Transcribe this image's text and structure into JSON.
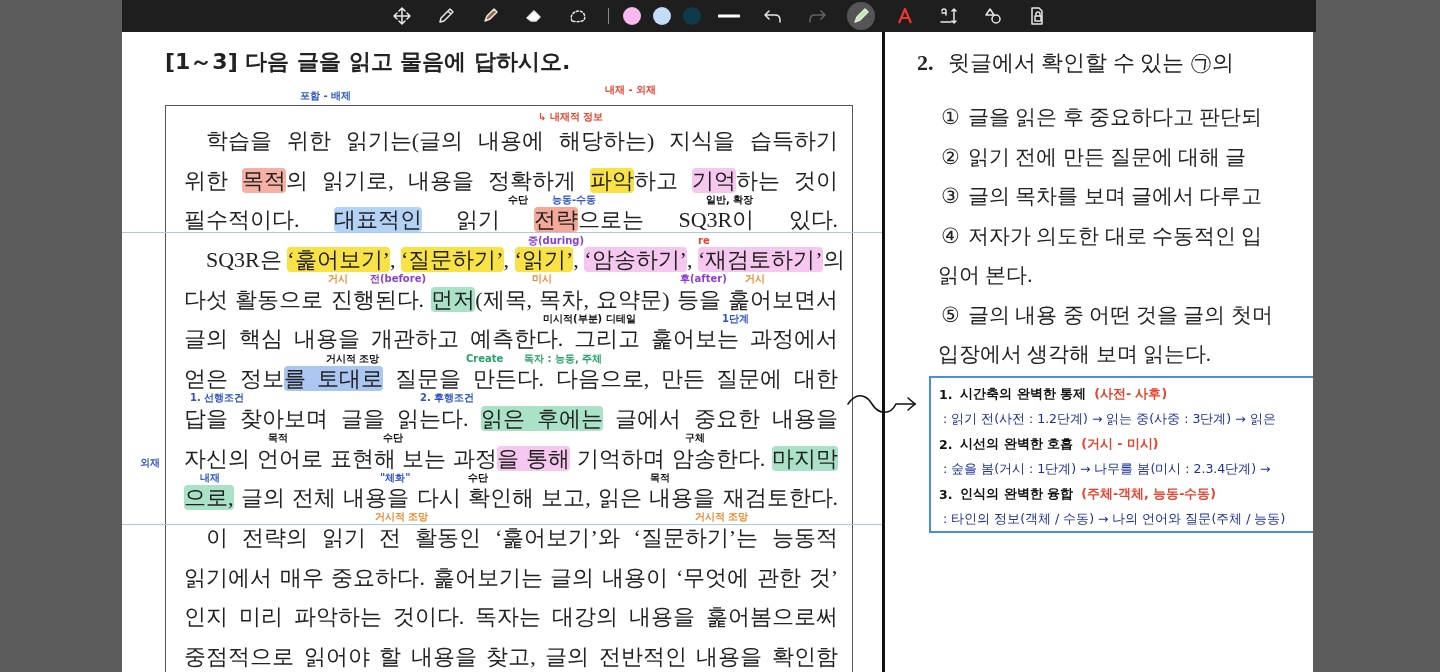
{
  "toolbar": {
    "tools": [
      {
        "kind": "move",
        "selected": false,
        "disabled": false
      },
      {
        "kind": "pen",
        "selected": false,
        "disabled": false
      },
      {
        "kind": "highlighter",
        "selected": false,
        "disabled": false
      },
      {
        "kind": "eraser",
        "selected": false,
        "disabled": false
      },
      {
        "kind": "lasso",
        "selected": false,
        "disabled": false
      }
    ],
    "colors": [
      {
        "color": "#f9b8f0",
        "selected": false
      },
      {
        "color": "#c3dcf8",
        "selected": false
      },
      {
        "color": "#0e3b4a",
        "selected": false
      }
    ],
    "actions": [
      {
        "kind": "stroke",
        "selected": false,
        "disabled": false
      },
      {
        "kind": "undo",
        "selected": false,
        "disabled": false
      },
      {
        "kind": "redo",
        "selected": false,
        "disabled": true
      },
      {
        "kind": "highlighter-pen",
        "selected": true,
        "disabled": false
      },
      {
        "kind": "text-color",
        "selected": false,
        "disabled": false
      },
      {
        "kind": "text-box",
        "selected": false,
        "disabled": false
      },
      {
        "kind": "shapes",
        "selected": false,
        "disabled": false
      },
      {
        "kind": "page-lock",
        "selected": false,
        "disabled": false
      }
    ]
  },
  "left_page": {
    "heading": "[1～3] 다음 글을 읽고 물음에 답하시오.",
    "paragraphs": [
      {
        "lines": [
          {
            "segments": [
              {
                "text": "학습을 위한 읽기는(글의 내용에 해당하는) 지식을 습득하기"
              }
            ]
          },
          {
            "segments": [
              {
                "text": "위한 "
              },
              {
                "text": "목적",
                "color": "#f7b1a4"
              },
              {
                "text": "의 읽기로, 내용을 정확하게 "
              },
              {
                "text": "파악",
                "color": "#f8e246"
              },
              {
                "text": "하고 "
              },
              {
                "text": "기억",
                "color": "#f6c8f0"
              },
              {
                "text": "하는 것이"
              }
            ]
          },
          {
            "segments": [
              {
                "text": "필수적이다. "
              },
              {
                "text": "대표적인",
                "color": "#b3d3f6"
              },
              {
                "text": " 읽기 "
              },
              {
                "text": "전략",
                "color": "#f4a89a"
              },
              {
                "text": "으로는 SQ3R이 있다."
              }
            ]
          }
        ]
      },
      {
        "lines": [
          {
            "segments": [
              {
                "text": "SQ3R은 "
              },
              {
                "text": "‘훑어보기’",
                "color": "#f8e246"
              },
              {
                "text": ", "
              },
              {
                "text": "‘질문하기’",
                "color": "#f8e246"
              },
              {
                "text": ", "
              },
              {
                "text": "‘읽기’",
                "color": "#f8e246"
              },
              {
                "text": ", "
              },
              {
                "text": "‘암송하기’",
                "color": "#f6c8f0"
              },
              {
                "text": ", "
              },
              {
                "text": "‘재검토하기’",
                "color": "#f6c8f0"
              },
              {
                "text": "의"
              }
            ]
          },
          {
            "segments": [
              {
                "text": "다섯 활동으로 진행된다. "
              },
              {
                "text": "먼저",
                "color": "#a9e2c6"
              },
              {
                "text": "(제목, 목차, 요약문) 등을 훑어보면서"
              }
            ]
          },
          {
            "segments": [
              {
                "text": "글의 핵심 내용을 개관하고 예측한다. 그리고 훑어보는 과정에서"
              }
            ]
          },
          {
            "segments": [
              {
                "text": "얻은 정보"
              },
              {
                "text": "를 토대로",
                "color": "#aac6f1"
              },
              {
                "text": " 질문을 만든다. 다음으로, 만든 질문에 대한"
              }
            ]
          },
          {
            "segments": [
              {
                "text": "답을 찾아보며 글을 읽는다. "
              },
              {
                "text": "읽은 후에는",
                "color": "#a9e2c6"
              },
              {
                "text": " 글에서 중요한 내용을"
              }
            ]
          },
          {
            "segments": [
              {
                "text": "자신의 언어로 표현해 보는 과정"
              },
              {
                "text": "을 통해",
                "color": "#f6c8f0"
              },
              {
                "text": " 기억하며 암송한다. "
              },
              {
                "text": "마지막",
                "color": "#a9e2c6"
              }
            ]
          },
          {
            "segments": [
              {
                "text": "으로,",
                "color": "#a9e2c6"
              },
              {
                "text": " 글의 전체 내용을 다시 확인해 보고, 읽은 내용을 재검토한다."
              }
            ]
          }
        ]
      },
      {
        "lines": [
          {
            "segments": [
              {
                "text": "이 전략의 읽기 전 활동인 ‘훑어보기’와 ‘질문하기’는 능동적"
              }
            ]
          },
          {
            "segments": [
              {
                "text": "읽기에서 매우 중요하다. 훑어보기는 글의 내용이 ‘무엇에 관한 것’"
              }
            ]
          },
          {
            "segments": [
              {
                "text": "인지 미리 파악하는 것이다. 독자는 대강의 내용을 훑어봄으로써"
              }
            ]
          },
          {
            "segments": [
              {
                "text": "중점적으로 읽어야 할 내용을 찾고, 글의 전반적인 내용을 확인함"
              }
            ]
          }
        ]
      }
    ],
    "annotations": [
      {
        "text": "포함 - 배제",
        "color": "#2d55c8"
      },
      {
        "text": "내재 - 외재",
        "color": "#e8412c"
      },
      {
        "text": "↳ 내재적 정보",
        "color": "#e8412c"
      },
      {
        "text": "수단",
        "color": "#111111"
      },
      {
        "text": "능동-수동",
        "color": "#2d55c8"
      },
      {
        "text": "일반, 확장",
        "color": "#111111"
      },
      {
        "text": "중(during)",
        "color": "#8a3fd1"
      },
      {
        "text": "re",
        "color": "#e8412c"
      },
      {
        "text": "거시",
        "color": "#f08a2c"
      },
      {
        "text": "전(before)",
        "color": "#8a3fd1"
      },
      {
        "text": "미시",
        "color": "#f08a2c"
      },
      {
        "text": "후(after)",
        "color": "#8a3fd1"
      },
      {
        "text": "거시",
        "color": "#f08a2c"
      },
      {
        "text": "미시적(부분) 디테일",
        "color": "#111111"
      },
      {
        "text": "1단계",
        "color": "#2d55c8"
      },
      {
        "text": "거시적 조망",
        "color": "#111111"
      },
      {
        "text": "Create",
        "color": "#2aa06a"
      },
      {
        "text": "독자 : 능동, 주체",
        "color": "#2aa06a"
      },
      {
        "text": "1. 선행조건",
        "color": "#2d55c8"
      },
      {
        "text": "2. 후행조건",
        "color": "#2d55c8"
      },
      {
        "text": "목적",
        "color": "#111111"
      },
      {
        "text": "수단",
        "color": "#111111"
      },
      {
        "text": "구체",
        "color": "#111111"
      },
      {
        "text": "외재",
        "color": "#2d55c8"
      },
      {
        "text": "내재",
        "color": "#2d55c8"
      },
      {
        "text": "\"체화\"",
        "color": "#2d55c8"
      },
      {
        "text": "수단",
        "color": "#111111"
      },
      {
        "text": "목적",
        "color": "#111111"
      },
      {
        "text": "거시적 조망",
        "color": "#f08a2c"
      },
      {
        "text": "거시적 조망",
        "color": "#f08a2c"
      }
    ]
  },
  "right_page": {
    "question_number": "2.",
    "question": "윗글에서 확인할 수 있는 ㉠의",
    "options": [
      {
        "marker": "①",
        "lines": [
          "글을 읽은 후 중요하다고 판단되"
        ]
      },
      {
        "marker": "②",
        "lines": [
          "읽기 전에 만든 질문에 대해 글"
        ]
      },
      {
        "marker": "③",
        "lines": [
          "글의 목차를 보며 글에서 다루고"
        ]
      },
      {
        "marker": "④",
        "lines": [
          "저자가 의도한 대로 수동적인 입",
          "읽어 본다."
        ]
      },
      {
        "marker": "⑤",
        "lines": [
          "글의 내용 중 어떤 것을 글의 첫머",
          "입장에서 생각해 보며 읽는다."
        ]
      }
    ],
    "note_box": [
      {
        "number": "1.",
        "title": "시간축의 완벽한 통제",
        "pair": "(사전- 사후)",
        "detail": ": 읽기 전(사전 : 1.2단계) → 읽는 중(사중 : 3단계) → 읽은"
      },
      {
        "number": "2.",
        "title": "시선의 완벽한 호흡",
        "pair": "(거시 - 미시)",
        "detail": ": 숲을 봄(거시 : 1단계) → 나무를 봄(미시 : 2.3.4단계) →"
      },
      {
        "number": "3.",
        "title": "인식의 완벽한 융합",
        "pair": "(주체-객체, 능동-수동)",
        "detail": ": 타인의 정보(객체 / 수동) → 나의 언어와 질문(주체 / 능동)"
      }
    ]
  }
}
